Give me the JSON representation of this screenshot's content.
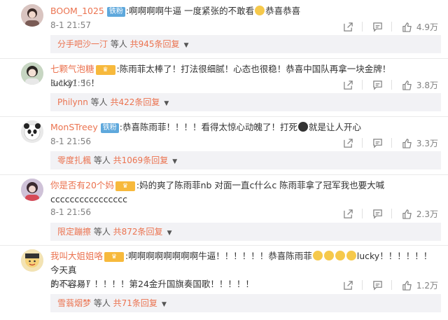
{
  "comments": [
    {
      "username": "BOOM_1025",
      "badge": "铁粉",
      "content": ":啊啊啊啊牛逼 一度紧张的不敢看",
      "content_after_emoji": "恭喜恭喜",
      "time": "8-1 21:57",
      "likes": "4.9万",
      "reply_user": "分手吧沙一汀",
      "reply_mid": " 等人 ",
      "reply_count": "共945条回复"
    },
    {
      "username": "七颗气泡糖",
      "content": ":陈雨菲太棒了！打法很细腻！心态也很稳！恭喜中国队再拿一块金牌！lucky！！！",
      "time": "8-1 21:56",
      "likes": "3.8万",
      "reply_user": "Philynn",
      "reply_mid": " 等人 ",
      "reply_count": "共422条回复"
    },
    {
      "username": "MonSTreey",
      "badge": "铁粉",
      "content": ":恭喜陈雨菲！！！！看得太惊心动魄了！打死",
      "content_after_emoji": "就是让人开心",
      "time": "8-1 21:56",
      "likes": "3.3万",
      "reply_user": "零度扎楓",
      "reply_mid": " 等人 ",
      "reply_count": "共1069条回复"
    },
    {
      "username": "你是否有20个妈",
      "content": ":妈的爽了陈雨菲nb 对面一直c什么c 陈雨菲拿了冠军我也要大喊",
      "content_line2": "cccccccccccccccc",
      "time": "8-1 21:56",
      "likes": "2.3万",
      "reply_user": "限定蹦擦",
      "reply_mid": " 等人 ",
      "reply_count": "共872条回复"
    },
    {
      "username": "我叫大姐姐咯",
      "content": ":啊啊啊啊啊啊啊啊牛逼！！！！！！恭喜陈雨菲",
      "content_after_emoji": "lucky！！！！！！今天真",
      "content_line2": "的不容易！！！！！第24金升国旗奏国歌！！！！！",
      "time": "8-1 21:57",
      "likes": "1.2万",
      "reply_user": "雪蓊烟梦",
      "reply_mid": " 等人 ",
      "reply_count": "共71条回复"
    }
  ],
  "icons": {
    "share": "share-icon",
    "comment": "comment-icon",
    "like": "like-icon",
    "expand": "caret-down-icon"
  },
  "colors": {
    "username": "#eb7350",
    "iron_badge": "#5ea8dc",
    "crown_badge": "#f7b93c",
    "reply_bg": "#f2f2f5"
  }
}
